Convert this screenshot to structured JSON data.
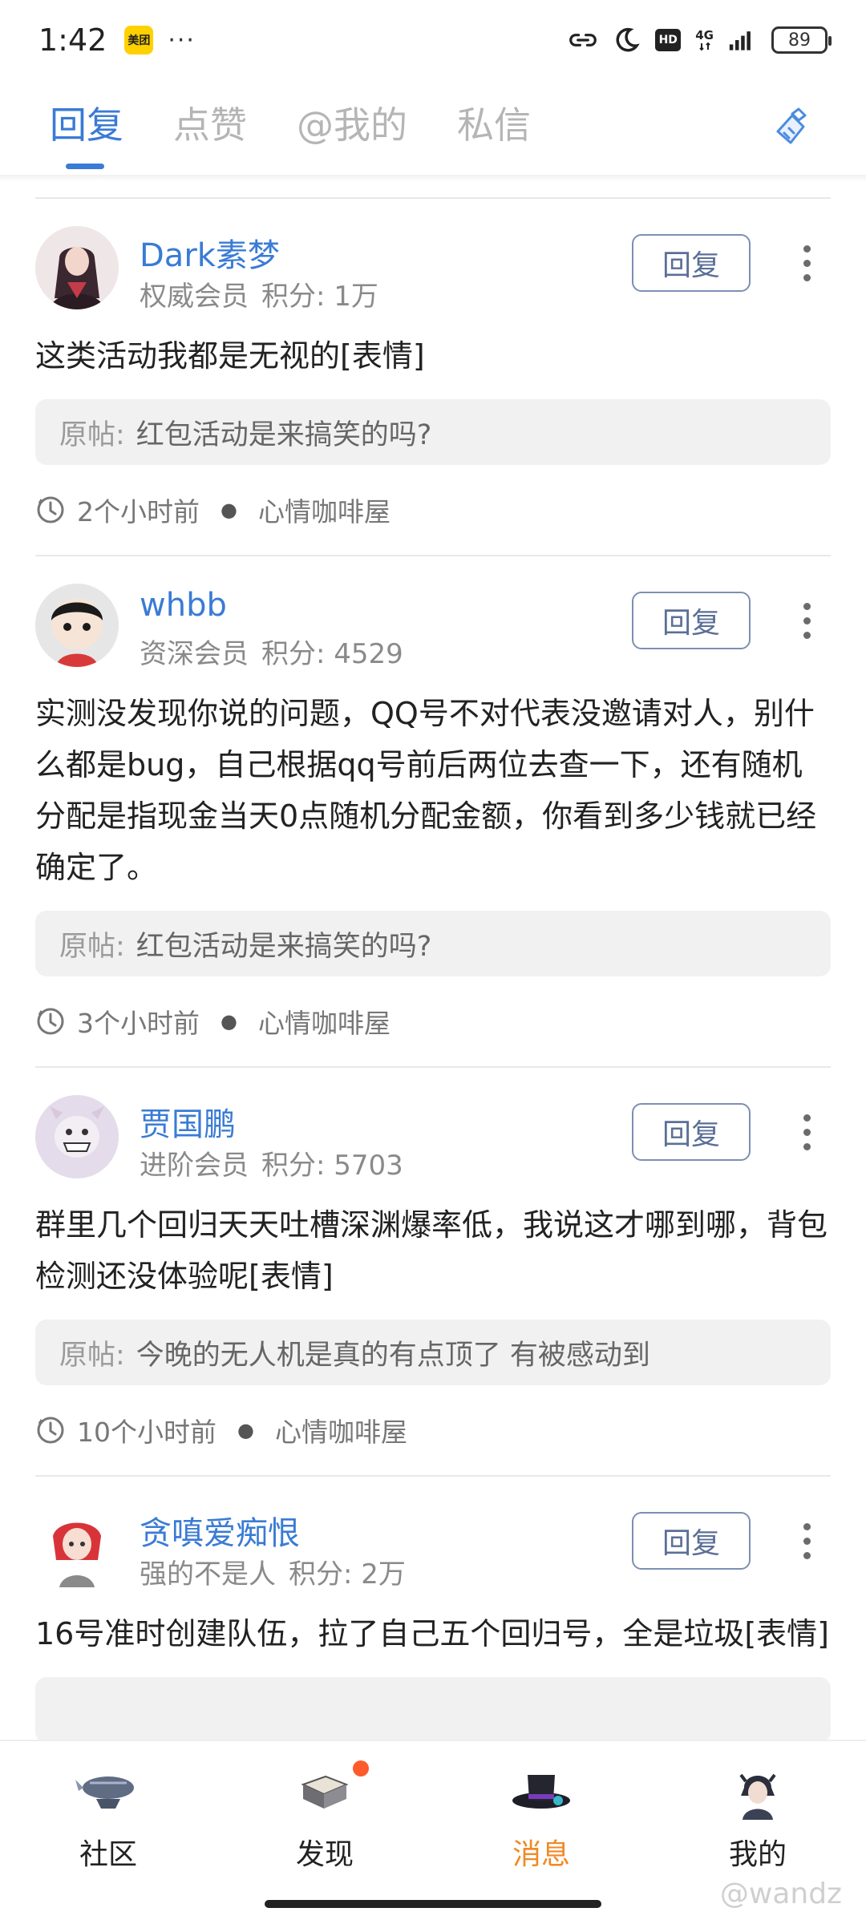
{
  "status_bar": {
    "time": "1:42",
    "app_badge": "美团",
    "dots": "···",
    "network": "4G",
    "hd": "HD",
    "battery": "89"
  },
  "tabs": [
    {
      "label": "回复",
      "active": true
    },
    {
      "label": "点赞",
      "active": false
    },
    {
      "label": "@我的",
      "active": false
    },
    {
      "label": "私信",
      "active": false
    }
  ],
  "reply_button_label": "回复",
  "origin_prefix": "原帖:",
  "posts": [
    {
      "username": "Dark素梦",
      "rank": "权威会员",
      "points": "积分: 1万",
      "content": "这类活动我都是无视的[表情]",
      "origin": "红包活动是来搞笑的吗?",
      "time": "2个小时前",
      "forum": "心情咖啡屋"
    },
    {
      "username": "whbb",
      "rank": "资深会员",
      "points": "积分: 4529",
      "content": "实测没发现你说的问题，QQ号不对代表没邀请对人，别什么都是bug，自己根据qq号前后两位去查一下，还有随机分配是指现金当天0点随机分配金额，你看到多少钱就已经确定了。",
      "origin": "红包活动是来搞笑的吗?",
      "time": "3个小时前",
      "forum": "心情咖啡屋"
    },
    {
      "username": "贾国鹏",
      "rank": "进阶会员",
      "points": "积分: 5703",
      "content": "群里几个回归天天吐槽深渊爆率低，我说这才哪到哪，背包检测还没体验呢[表情]",
      "origin": "今晚的无人机是真的有点顶了 有被感动到",
      "time": "10个小时前",
      "forum": "心情咖啡屋"
    },
    {
      "username": "贪嗔爱痴恨",
      "rank": "强的不是人",
      "points": "积分: 2万",
      "content": "16号准时创建队伍，拉了自己五个回归号，全是垃圾[表情]",
      "origin": "",
      "time": "",
      "forum": ""
    }
  ],
  "bottom_nav": [
    {
      "label": "社区",
      "icon": "airship-icon",
      "active": false
    },
    {
      "label": "发现",
      "icon": "book-icon",
      "active": false,
      "badge": true
    },
    {
      "label": "消息",
      "icon": "top-hat-icon",
      "active": true
    },
    {
      "label": "我的",
      "icon": "character-avatar-icon",
      "active": false
    }
  ],
  "watermark": "@wandz",
  "colors": {
    "accent_blue": "#3a7bd5",
    "active_orange": "#f08a24",
    "badge_red": "#ff5a2a"
  }
}
